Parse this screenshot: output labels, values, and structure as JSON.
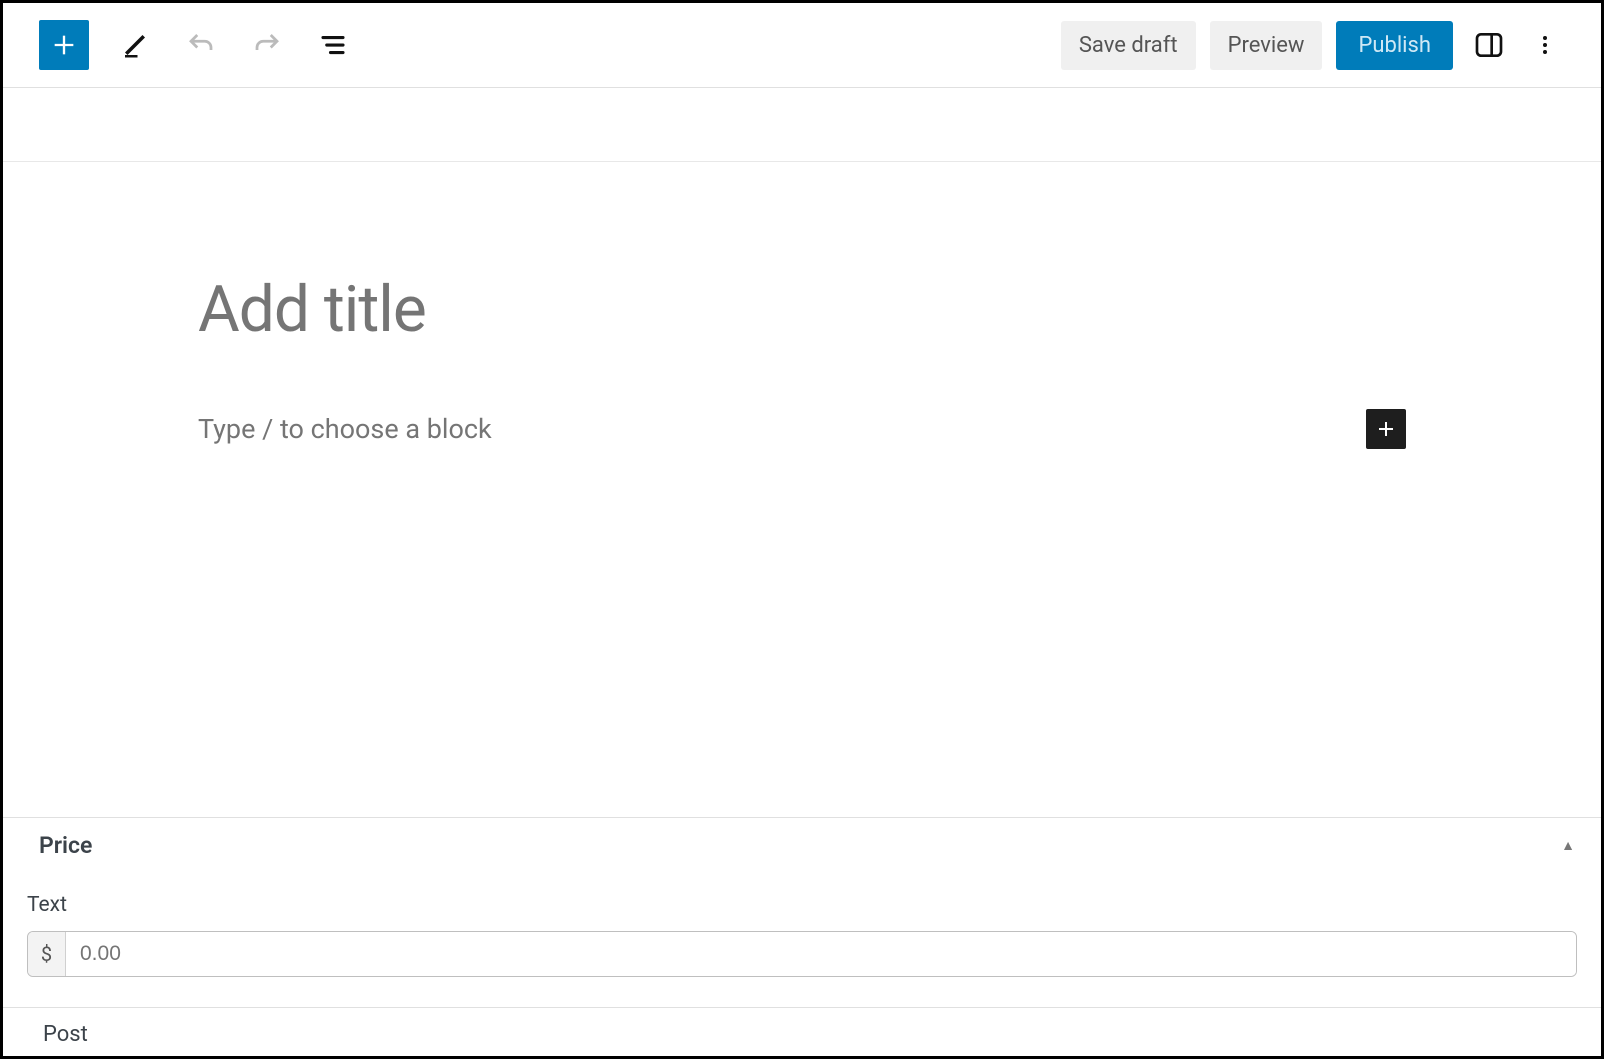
{
  "toolbar": {
    "save_draft_label": "Save draft",
    "preview_label": "Preview",
    "publish_label": "Publish"
  },
  "editor": {
    "title_placeholder": "Add title",
    "block_placeholder": "Type / to choose a block"
  },
  "metabox": {
    "title": "Price",
    "field_label": "Text",
    "input_prefix": "$",
    "input_placeholder": "0.00",
    "input_value": ""
  },
  "bottom_tab": {
    "label": "Post"
  }
}
